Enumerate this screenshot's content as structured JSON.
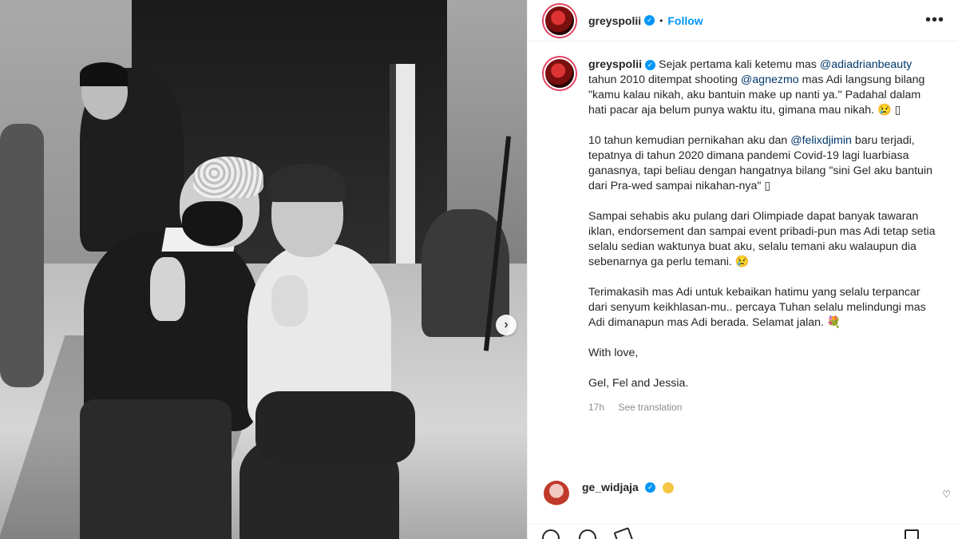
{
  "post": {
    "username": "greyspolii",
    "verified": true,
    "follow_label": "Follow",
    "separator": "•",
    "more_label": "•••"
  },
  "caption": {
    "author": "greyspolii",
    "paragraphs": [
      [
        {
          "text": "Sejak pertama kali ketemu mas "
        },
        {
          "text": "@adiadrianbeauty",
          "mention": true
        },
        {
          "text": " tahun 2010 ditempat shooting "
        },
        {
          "text": "@agnezmo",
          "mention": true
        },
        {
          "text": " mas Adi langsung bilang \"kamu kalau nikah, aku bantuin make up nanti ya.\" Padahal dalam hati pacar aja belum punya waktu itu, gimana mau nikah. 😢 ▯"
        }
      ],
      [
        {
          "text": "10 tahun kemudian pernikahan aku dan "
        },
        {
          "text": "@felixdjimin",
          "mention": true
        },
        {
          "text": " baru terjadi, tepatnya di tahun 2020 dimana pandemi Covid-19 lagi luarbiasa ganasnya, tapi beliau dengan hangatnya bilang \"sini Gel aku bantuin dari Pra-wed sampai nikahan-nya\" ▯"
        }
      ],
      [
        {
          "text": "Sampai sehabis aku pulang dari Olimpiade dapat banyak tawaran iklan, endorsement dan sampai event pribadi-pun mas Adi tetap setia selalu sedian waktunya buat aku, selalu temani aku walaupun dia sebenarnya ga perlu temani. 😢"
        }
      ],
      [
        {
          "text": "Terimakasih mas Adi untuk kebaikan hatimu yang selalu terpancar dari senyum keikhlasan-mu.. percaya Tuhan selalu melindungi mas Adi dimanapun mas Adi berada. Selamat jalan. 💐"
        }
      ],
      [
        {
          "text": "With love,"
        }
      ],
      [
        {
          "text": "Gel, Fel and Jessia."
        }
      ]
    ],
    "time": "17h",
    "translate_label": "See translation"
  },
  "comment": {
    "username": "ge_widjaja",
    "verified": true,
    "heart_label": "♡"
  },
  "photo": {
    "next_label": "›"
  },
  "colors": {
    "link": "#00376b",
    "follow": "#0095f6",
    "verified": "#0095f6",
    "muted": "#8e8e8e"
  }
}
